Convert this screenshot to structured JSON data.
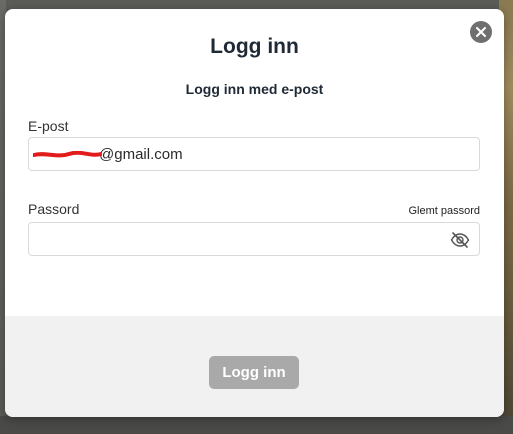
{
  "modal": {
    "title": "Logg inn",
    "subtitle": "Logg inn med e-post",
    "close_icon": "close-icon"
  },
  "form": {
    "email_label": "E-post",
    "email_value_visible": "@gmail.com",
    "email_local_part_redacted": true,
    "password_label": "Passord",
    "forgot_password": "Glemt passord",
    "password_value": "",
    "password_toggle_icon": "eye-slash-icon"
  },
  "footer": {
    "submit_label": "Logg inn"
  },
  "colors": {
    "title_text": "#1f2a36",
    "submit_bg_disabled": "#a9a9a9",
    "close_bg": "#6f6f6f",
    "footer_bg": "#f1f1f1",
    "redaction": "#e21b1b"
  }
}
